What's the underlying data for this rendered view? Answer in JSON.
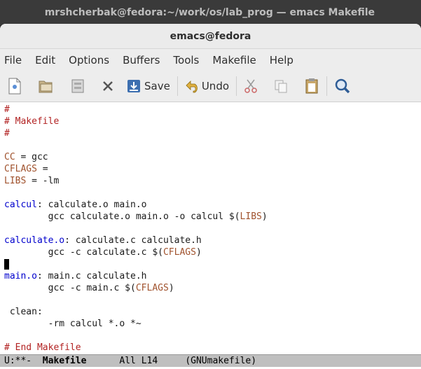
{
  "outer_title": "mrshcherbak@fedora:~/work/os/lab_prog — emacs Makefile",
  "window_title": "emacs@fedora",
  "menu": [
    "File",
    "Edit",
    "Options",
    "Buffers",
    "Tools",
    "Makefile",
    "Help"
  ],
  "toolbar": {
    "save_label": "Save",
    "undo_label": "Undo"
  },
  "code": {
    "l1": "#",
    "l2": "# Makefile",
    "l3": "#",
    "cc_name": "CC",
    "cc_rest": " = gcc",
    "cflags_name": "CFLAGS",
    "cflags_rest": " =",
    "libs_name": "LIBS",
    "libs_rest": " = -lm",
    "calcul_target": "calcul",
    "calcul_deps": ": calculate.o main.o",
    "calcul_cmd_a": "        gcc calculate.o main.o -o calcul $(",
    "calcul_cmd_var": "LIBS",
    "calcul_cmd_b": ")",
    "calc_target": "calculate.o",
    "calc_deps": ": calculate.c calculate.h",
    "calc_cmd_a": "        gcc -c calculate.c $(",
    "calc_cmd_var": "CFLAGS",
    "calc_cmd_b": ")",
    "main_target": "main.o",
    "main_deps": ": main.c calculate.h",
    "main_cmd_a": "        gcc -c main.c $(",
    "main_cmd_var": "CFLAGS",
    "main_cmd_b": ")",
    "clean": " clean:",
    "clean_cmd": "        -rm calcul *.o *~",
    "end": "# End Makefile"
  },
  "modeline": {
    "status": "U:**-  ",
    "buffer": "Makefile",
    "position": "      All L14     ",
    "mode": "(GNUmakefile)"
  }
}
